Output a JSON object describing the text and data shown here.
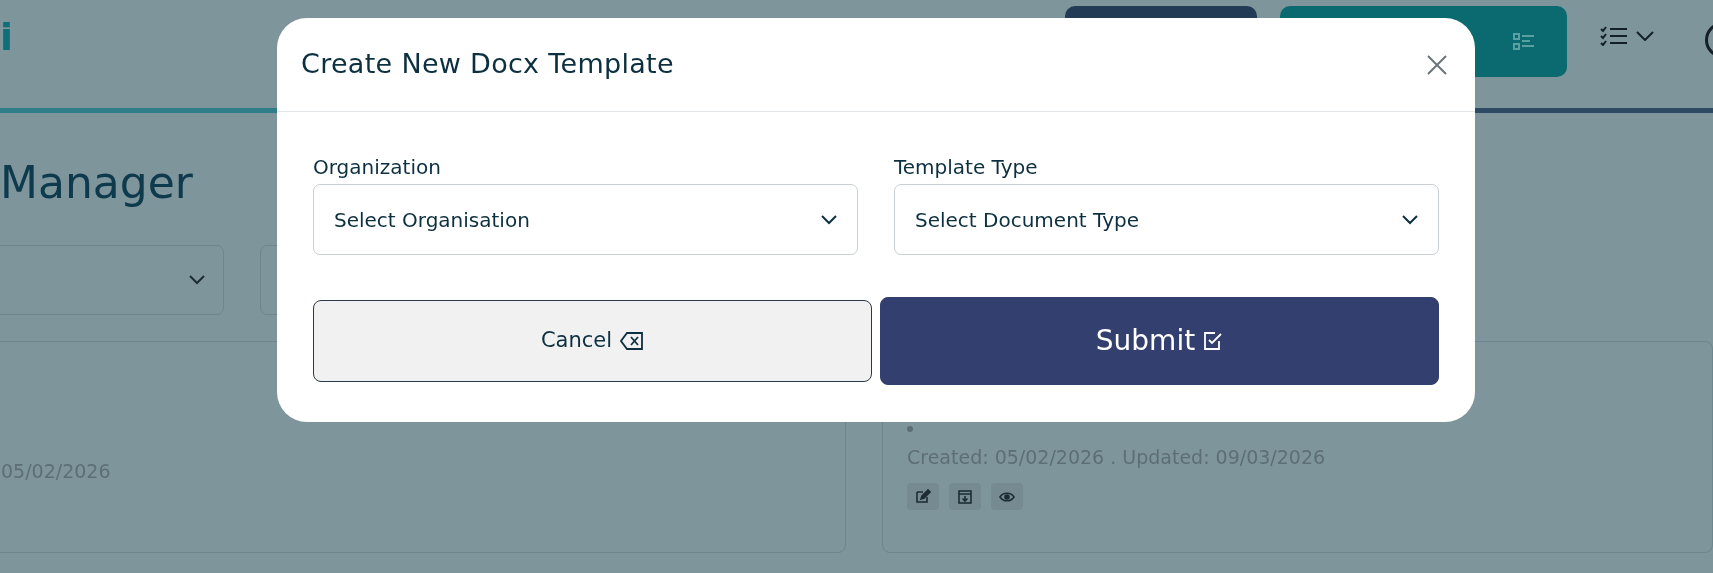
{
  "header": {
    "logo": "i"
  },
  "page": {
    "heading": "Manager"
  },
  "cards": [
    {
      "dates": "05/02/2026"
    },
    {
      "dates": "Created: 05/02/2026 . Updated: 09/03/2026",
      "actions": [
        {
          "kind": "edit"
        },
        {
          "kind": "download"
        },
        {
          "kind": "view"
        }
      ]
    }
  ],
  "modal": {
    "title": "Create New Docx Template",
    "fields": [
      {
        "label": "Organization",
        "value": "Select Organisation"
      },
      {
        "label": "Template Type",
        "value": "Select Document Type"
      }
    ],
    "buttons": [
      {
        "label": "Cancel",
        "kind": "secondary"
      },
      {
        "label": "Submit",
        "kind": "primary"
      }
    ]
  }
}
